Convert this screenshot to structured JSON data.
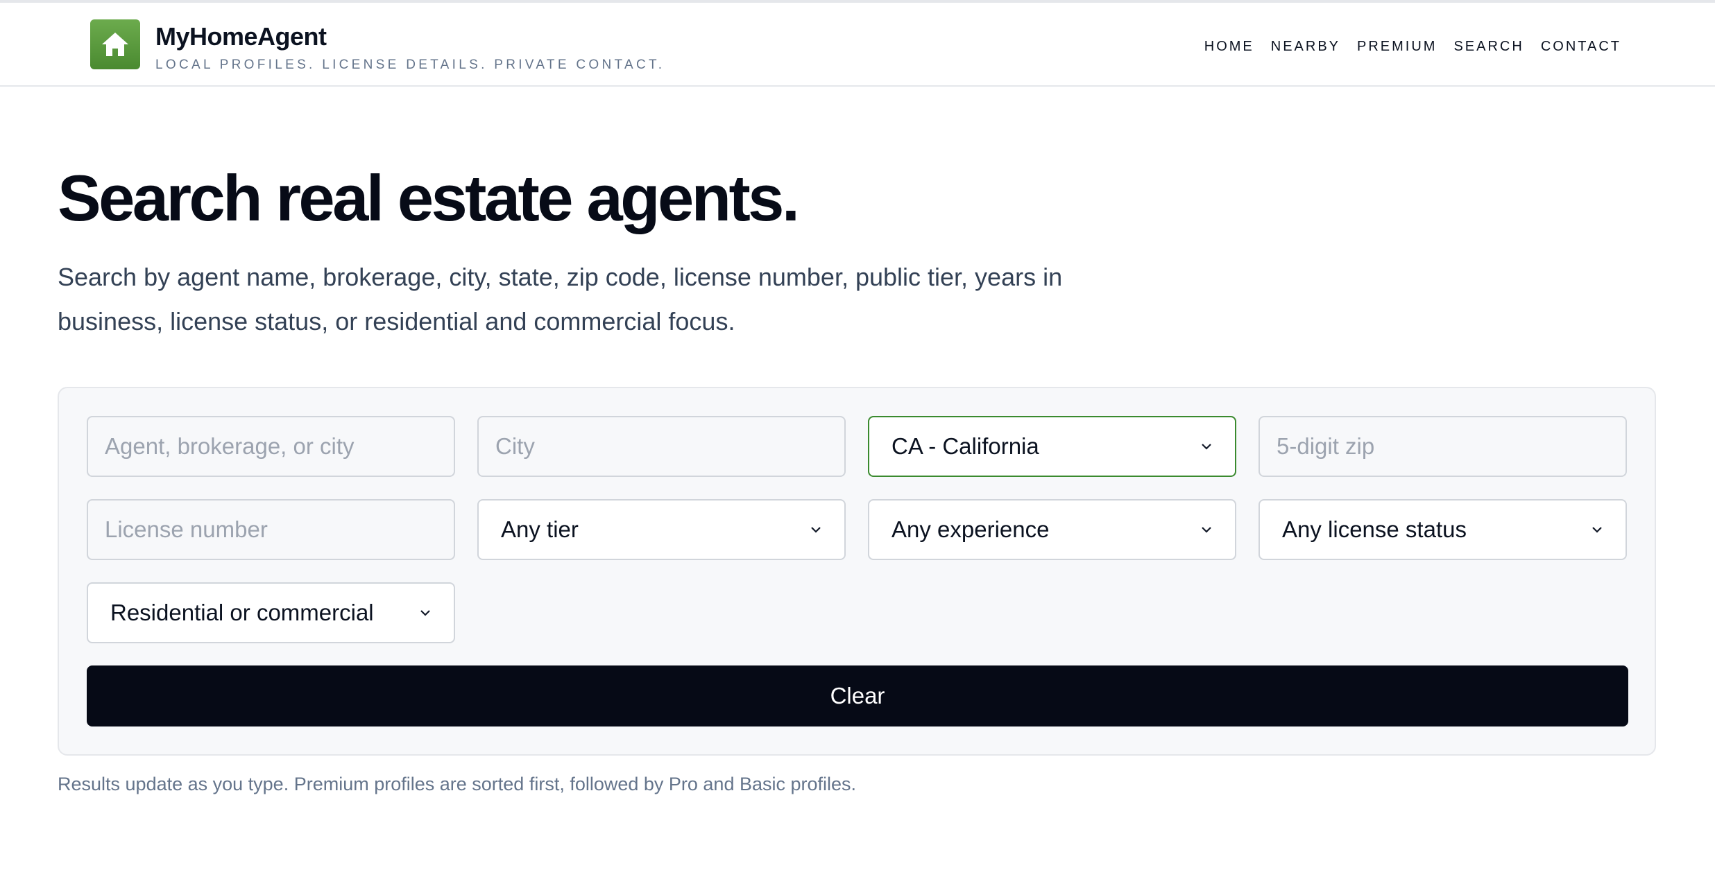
{
  "brand": {
    "name": "MyHomeAgent",
    "tagline": "LOCAL PROFILES. LICENSE DETAILS. PRIVATE CONTACT.",
    "logo_icon": "house-icon",
    "logo_color": "#5a9b3e"
  },
  "nav": {
    "items": [
      {
        "label": "HOME"
      },
      {
        "label": "NEARBY"
      },
      {
        "label": "PREMIUM"
      },
      {
        "label": "SEARCH"
      },
      {
        "label": "CONTACT"
      }
    ]
  },
  "main": {
    "title": "Search real estate agents.",
    "description": "Search by agent name, brokerage, city, state, zip code, license number, public tier, years in business, license status, or residential and commercial focus."
  },
  "search": {
    "agent_placeholder": "Agent, brokerage, or city",
    "city_placeholder": "City",
    "state_value": "CA - California",
    "zip_placeholder": "5-digit zip",
    "license_placeholder": "License number",
    "tier_value": "Any tier",
    "experience_value": "Any experience",
    "license_status_value": "Any license status",
    "focus_value": "Residential or commercial",
    "clear_label": "Clear"
  },
  "results_note": "Results update as you type. Premium profiles are sorted first, followed by Pro and Basic profiles.",
  "colors": {
    "accent_green": "#3a8a2e",
    "button_dark": "#060a16"
  }
}
